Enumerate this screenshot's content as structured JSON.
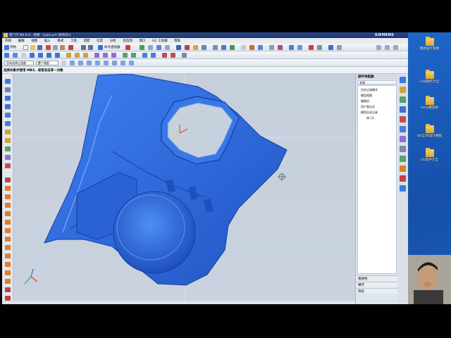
{
  "window": {
    "title": "西门子 NX 8.0 - 建模 - [pipe.prt  (修改的)]",
    "brand": "SIEMENS"
  },
  "menu": [
    "开始",
    "编辑",
    "视图",
    "插入",
    "格式",
    "工具",
    "装配",
    "信息",
    "分析",
    "首选项",
    "窗口",
    "GC 工具箱",
    "帮助"
  ],
  "toolbar": {
    "start_label": "开始",
    "command_finder": "命令查找器",
    "filter_value": "没有选择过滤器",
    "assembly_value": "整个装配"
  },
  "cue_line": "选择对象并使用 MB3，或者双击某一对象",
  "navigator": {
    "title": "部件导航器",
    "column_header": "名称",
    "items": [
      "历史记录模式",
      "模型视图",
      "摄像机",
      "用户表达式",
      "模型历史记录",
      "体 (1)"
    ],
    "sections": [
      "相依性",
      "细节",
      "预览"
    ]
  },
  "desktop": {
    "icons": [
      "模具设计案例",
      "CAD制作大全",
      "UG分模案例",
      "UG全3D设计教程",
      "UG软件大全"
    ]
  },
  "colors": {
    "model_blue": "#2f6fe0",
    "background": "#c9d2de",
    "desktop_blue": "#1b5cb8"
  }
}
